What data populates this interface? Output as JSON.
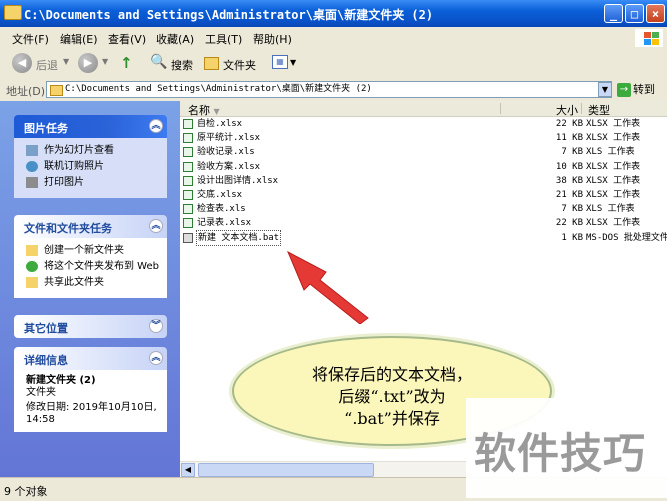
{
  "window": {
    "title": "C:\\Documents and Settings\\Administrator\\桌面\\新建文件夹 (2)"
  },
  "menu": [
    "文件(F)",
    "编辑(E)",
    "查看(V)",
    "收藏(A)",
    "工具(T)",
    "帮助(H)"
  ],
  "toolbar": {
    "back": "后退",
    "search": "搜索",
    "folders": "文件夹"
  },
  "address": {
    "label": "地址(D)",
    "value": "C:\\Documents and Settings\\Administrator\\桌面\\新建文件夹 (2)",
    "go": "转到"
  },
  "sidebar": {
    "picture_tasks": {
      "title": "图片任务",
      "items": [
        "作为幻灯片查看",
        "联机订购照片",
        "打印图片"
      ]
    },
    "file_tasks": {
      "title": "文件和文件夹任务",
      "items": [
        "创建一个新文件夹",
        "将这个文件夹发布到 Web",
        "共享此文件夹"
      ]
    },
    "other_places": {
      "title": "其它位置"
    },
    "details": {
      "title": "详细信息",
      "name": "新建文件夹 (2)",
      "type": "文件夹",
      "modified": "修改日期: 2019年10月10日, 14:58"
    }
  },
  "columns": {
    "name": "名称",
    "size": "大小",
    "type": "类型"
  },
  "files": [
    {
      "name": "自检.xlsx",
      "size": "22 KB",
      "type": "XLSX 工作表"
    },
    {
      "name": "原平统计.xlsx",
      "size": "11 KB",
      "type": "XLSX 工作表"
    },
    {
      "name": "验收记录.xls",
      "size": "7 KB",
      "type": "XLS 工作表"
    },
    {
      "name": "验收方案.xlsx",
      "size": "10 KB",
      "type": "XLSX 工作表"
    },
    {
      "name": "设计出图详情.xlsx",
      "size": "38 KB",
      "type": "XLSX 工作表"
    },
    {
      "name": "交底.xlsx",
      "size": "21 KB",
      "type": "XLSX 工作表"
    },
    {
      "name": "检查表.xls",
      "size": "7 KB",
      "type": "XLS 工作表"
    },
    {
      "name": "记录表.xlsx",
      "size": "22 KB",
      "type": "XLSX 工作表"
    },
    {
      "name": "新建 文本文档.bat",
      "size": "1 KB",
      "type": "MS-DOS 批处理文件"
    }
  ],
  "status": "9 个对象",
  "callout": {
    "line1": "将保存后的文本文档，",
    "line2": "后缀“.txt”改为",
    "line3": "“.bat”并保存"
  },
  "watermark": "软件技巧"
}
